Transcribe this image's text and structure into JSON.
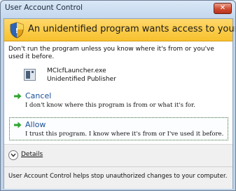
{
  "window": {
    "title": "User Account Control",
    "close_glyph": "✕"
  },
  "banner": {
    "text": "An unidentified program wants access to your computer",
    "icon": "shield-icon"
  },
  "warning": {
    "text": "Don't run the program unless you know where it's from or you've used it before."
  },
  "program": {
    "name": "MCIcfLauncher.exe",
    "publisher": "Unidentified Publisher",
    "icon": "program-icon"
  },
  "options": {
    "cancel": {
      "title": "Cancel",
      "description": "I don't know where this program is from or what it's for."
    },
    "allow": {
      "title": "Allow",
      "description": "I trust this program. I know where it's from or I've used it before."
    }
  },
  "footer": {
    "details_label": "Details",
    "info_text": "User Account Control helps stop unauthorized changes to your computer."
  },
  "colors": {
    "banner": "#f7c12e",
    "link": "#1b4f94",
    "arrow": "#2ea52e",
    "close": "#cf4b31"
  }
}
